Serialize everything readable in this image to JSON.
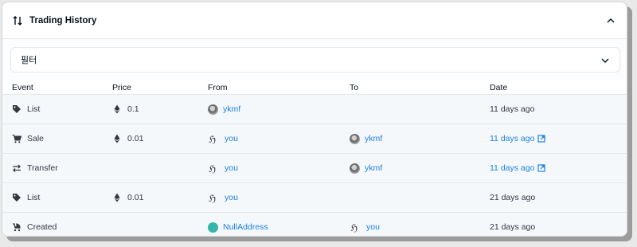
{
  "header": {
    "title": "Trading History",
    "sort_icon": "swap-vertical-icon",
    "collapse_icon": "chevron-up-icon"
  },
  "filter": {
    "label": "필터",
    "chevron_icon": "chevron-down-icon"
  },
  "columns": [
    "Event",
    "Price",
    "From",
    "To",
    "Date"
  ],
  "rows": [
    {
      "event": "List",
      "event_icon": "tag-icon",
      "price": "0.1",
      "from": "ykmf",
      "from_avatar": "photo",
      "to": "",
      "to_avatar": "",
      "date": "11 days ago",
      "date_link": false
    },
    {
      "event": "Sale",
      "event_icon": "cart-icon",
      "price": "0.01",
      "from": "you",
      "from_avatar": "glyph",
      "to": "ykmf",
      "to_avatar": "photo",
      "date": "11 days ago",
      "date_link": true
    },
    {
      "event": "Transfer",
      "event_icon": "transfer-icon",
      "price": "",
      "from": "you",
      "from_avatar": "glyph",
      "to": "ykmf",
      "to_avatar": "photo",
      "date": "11 days ago",
      "date_link": true
    },
    {
      "event": "List",
      "event_icon": "tag-icon",
      "price": "0.01",
      "from": "you",
      "from_avatar": "glyph",
      "to": "",
      "to_avatar": "",
      "date": "21 days ago",
      "date_link": false
    },
    {
      "event": "Created",
      "event_icon": "stroller-icon",
      "price": "",
      "from": "NullAddress",
      "from_avatar": "teal",
      "to": "you",
      "to_avatar": "glyph",
      "date": "21 days ago",
      "date_link": false
    }
  ],
  "colors": {
    "link": "#2081e2",
    "row_bg": "#f4f8fb",
    "border": "#e5e8eb",
    "null_avatar": "#36b7a9"
  }
}
